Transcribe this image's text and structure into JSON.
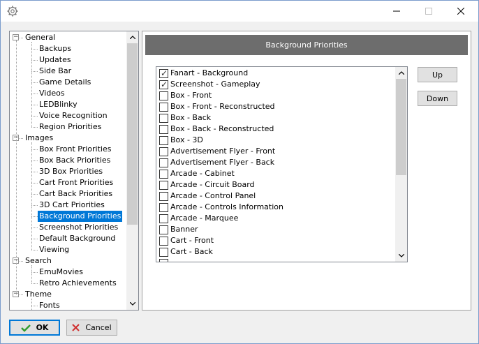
{
  "window": {
    "icon": "gear-icon"
  },
  "tree": {
    "items": [
      {
        "label": "General",
        "level": 0,
        "expanded": true
      },
      {
        "label": "Backups",
        "level": 1
      },
      {
        "label": "Updates",
        "level": 1
      },
      {
        "label": "Side Bar",
        "level": 1
      },
      {
        "label": "Game Details",
        "level": 1
      },
      {
        "label": "Videos",
        "level": 1
      },
      {
        "label": "LEDBlinky",
        "level": 1
      },
      {
        "label": "Voice Recognition",
        "level": 1
      },
      {
        "label": "Region Priorities",
        "level": 1
      },
      {
        "label": "Images",
        "level": 0,
        "expanded": true
      },
      {
        "label": "Box Front Priorities",
        "level": 1
      },
      {
        "label": "Box Back Priorities",
        "level": 1
      },
      {
        "label": "3D Box Priorities",
        "level": 1
      },
      {
        "label": "Cart Front Priorities",
        "level": 1
      },
      {
        "label": "Cart Back Priorities",
        "level": 1
      },
      {
        "label": "3D Cart Priorities",
        "level": 1
      },
      {
        "label": "Background Priorities",
        "level": 1,
        "selected": true
      },
      {
        "label": "Screenshot Priorities",
        "level": 1
      },
      {
        "label": "Default Background",
        "level": 1
      },
      {
        "label": "Viewing",
        "level": 1
      },
      {
        "label": "Search",
        "level": 0,
        "expanded": true
      },
      {
        "label": "EmuMovies",
        "level": 1
      },
      {
        "label": "Retro Achievements",
        "level": 1
      },
      {
        "label": "Theme",
        "level": 0,
        "expanded": true
      },
      {
        "label": "Fonts",
        "level": 1
      }
    ]
  },
  "panel": {
    "title": "Background Priorities",
    "up_label": "Up",
    "down_label": "Down",
    "list": [
      {
        "label": "Fanart - Background",
        "checked": true
      },
      {
        "label": "Screenshot - Gameplay",
        "checked": true
      },
      {
        "label": "Box - Front",
        "checked": false
      },
      {
        "label": "Box - Front - Reconstructed",
        "checked": false
      },
      {
        "label": "Box - Back",
        "checked": false
      },
      {
        "label": "Box - Back - Reconstructed",
        "checked": false
      },
      {
        "label": "Box - 3D",
        "checked": false
      },
      {
        "label": "Advertisement Flyer - Front",
        "checked": false
      },
      {
        "label": "Advertisement Flyer - Back",
        "checked": false
      },
      {
        "label": "Arcade - Cabinet",
        "checked": false
      },
      {
        "label": "Arcade - Circuit Board",
        "checked": false
      },
      {
        "label": "Arcade - Control Panel",
        "checked": false
      },
      {
        "label": "Arcade - Controls Information",
        "checked": false
      },
      {
        "label": "Arcade - Marquee",
        "checked": false
      },
      {
        "label": "Banner",
        "checked": false
      },
      {
        "label": "Cart - Front",
        "checked": false
      },
      {
        "label": "Cart - Back",
        "checked": false
      },
      {
        "label": "",
        "checked": false
      }
    ]
  },
  "footer": {
    "ok_label": "OK",
    "cancel_label": "Cancel"
  },
  "colors": {
    "selection": "#0078d7",
    "header_bar": "#6d6d6d",
    "ok_icon": "#2e9c2e",
    "cancel_icon": "#d03030"
  }
}
